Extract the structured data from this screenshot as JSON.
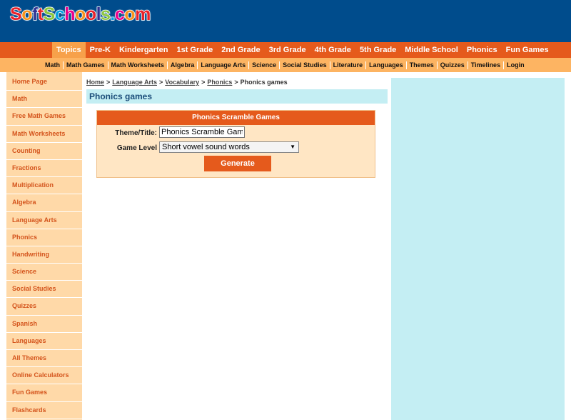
{
  "header": {
    "logo_letters": [
      {
        "ch": "S",
        "color": "#e8222b"
      },
      {
        "ch": "o",
        "color": "#f7941d"
      },
      {
        "ch": "f",
        "color": "#2e3192"
      },
      {
        "ch": "t",
        "color": "#e8222b"
      },
      {
        "ch": "S",
        "color": "#8cc63f"
      },
      {
        "ch": "c",
        "color": "#00a0e3"
      },
      {
        "ch": "h",
        "color": "#ec008c"
      },
      {
        "ch": "o",
        "color": "#f7941d"
      },
      {
        "ch": "o",
        "color": "#e8222b"
      },
      {
        "ch": "l",
        "color": "#2e3192"
      },
      {
        "ch": "s",
        "color": "#8cc63f"
      },
      {
        "ch": ".",
        "color": "#00a0e3"
      },
      {
        "ch": "c",
        "color": "#ec008c"
      },
      {
        "ch": "o",
        "color": "#f7941d"
      },
      {
        "ch": "m",
        "color": "#e8222b"
      }
    ]
  },
  "topnav": {
    "items": [
      "Topics",
      "Pre-K",
      "Kindergarten",
      "1st Grade",
      "2nd Grade",
      "3rd Grade",
      "4th Grade",
      "5th Grade",
      "Middle School",
      "Phonics",
      "Fun Games"
    ]
  },
  "subnav": {
    "items": [
      "Math",
      "Math Games",
      "Math Worksheets",
      "Algebra",
      "Language Arts",
      "Science",
      "Social Studies",
      "Literature",
      "Languages",
      "Themes",
      "Quizzes",
      "Timelines",
      "Login"
    ]
  },
  "sidebar": {
    "items": [
      "Home Page",
      "Math",
      "Free Math Games",
      "Math Worksheets",
      "Counting",
      "Fractions",
      "Multiplication",
      "Algebra",
      "Language Arts",
      "Phonics",
      "Handwriting",
      "Science",
      "Social Studies",
      "Quizzes",
      "Spanish",
      "Languages",
      "All Themes",
      "Online Calculators",
      "Fun Games",
      "Flashcards"
    ]
  },
  "breadcrumb": {
    "links": [
      "Home",
      "Language Arts",
      "Vocabulary",
      "Phonics"
    ],
    "separator": ">",
    "current": "Phonics games"
  },
  "page": {
    "title": "Phonics games"
  },
  "form": {
    "header": "Phonics Scramble Games",
    "theme_label": "Theme/Title:",
    "theme_value": "Phonics Scramble Games",
    "level_label": "Game Level",
    "level_value": "Short vowel sound words",
    "generate_label": "Generate"
  },
  "colors": {
    "header_bg": "#004c8c",
    "nav_orange": "#e55a1c",
    "subnav_bg": "#fdb462",
    "sidebar_bg": "#ffd9a8",
    "light_blue": "#c4eef3"
  }
}
